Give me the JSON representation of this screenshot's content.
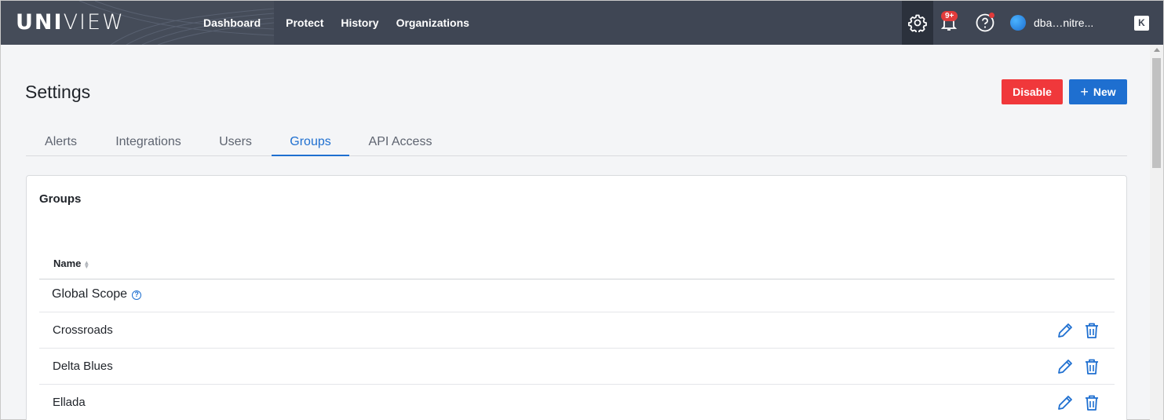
{
  "brand": {
    "logo_bold": "UNI",
    "logo_thin": "VIEW"
  },
  "nav": {
    "links": [
      "Dashboard",
      "Protect",
      "History",
      "Organizations"
    ]
  },
  "toolbar": {
    "settings_icon": "gear-icon",
    "notifications_icon": "bell-icon",
    "notifications_count": "9+",
    "help_icon": "question-circle-icon",
    "user_name": "dba…nitre...",
    "org_switch_label": "K"
  },
  "page": {
    "title": "Settings",
    "disable_label": "Disable",
    "new_label": "New",
    "new_icon": "+"
  },
  "tabs": [
    {
      "label": "Alerts",
      "active": false
    },
    {
      "label": "Integrations",
      "active": false
    },
    {
      "label": "Users",
      "active": false
    },
    {
      "label": "Groups",
      "active": true
    },
    {
      "label": "API Access",
      "active": false
    }
  ],
  "card": {
    "title": "Groups",
    "columns": {
      "name": "Name"
    },
    "rows": [
      {
        "name": "Global Scope",
        "editable": false
      },
      {
        "name": "Crossroads",
        "editable": true
      },
      {
        "name": "Delta Blues",
        "editable": true
      },
      {
        "name": "Ellada",
        "editable": true
      }
    ]
  },
  "colors": {
    "topbar": "#3f4654",
    "accent": "#1e6fd0",
    "danger": "#f0383b"
  }
}
